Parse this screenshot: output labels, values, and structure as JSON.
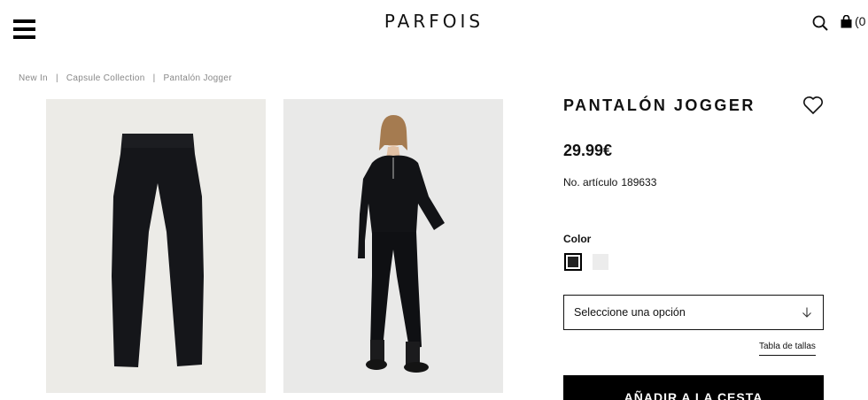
{
  "header": {
    "logo": "PARFOIS",
    "bag_count": "(0",
    "icons": [
      "menu-icon",
      "search-icon",
      "shopping-bag-icon"
    ]
  },
  "breadcrumb": {
    "items": [
      "New In",
      "Capsule Collection",
      "Pantalón Jogger"
    ],
    "separator": "|"
  },
  "product": {
    "title": "PANTALÓN JOGGER",
    "price": "29.99€",
    "sku_label": "No. artículo",
    "sku_value": "189633",
    "color_label": "Color",
    "colors": [
      "#222222",
      "#ececec"
    ],
    "selected_color_index": 0,
    "size_select_placeholder": "Seleccione una opción",
    "size_table_link": "Tabla de tallas",
    "add_to_cart": "AÑADIR A LA CESTA"
  }
}
